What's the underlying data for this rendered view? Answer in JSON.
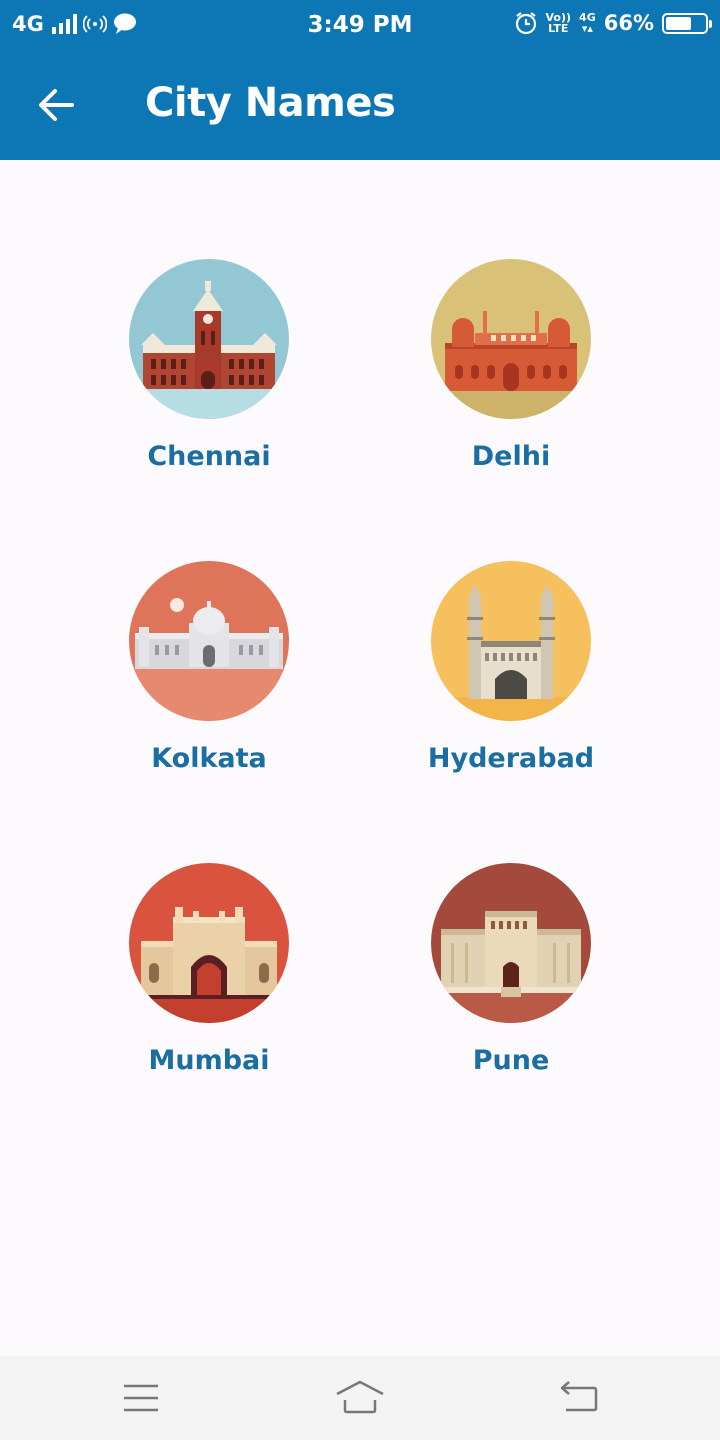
{
  "status_bar": {
    "network": "4G",
    "time": "3:49 PM",
    "volte_top": "Vo))",
    "volte_bottom": "LTE",
    "net_type": "4G",
    "battery_percent": "66%",
    "battery_level": 0.66
  },
  "header": {
    "title": "City Names",
    "background_color": "#0d77b5"
  },
  "cities": [
    {
      "name": "Chennai",
      "icon": "chennai-central-icon",
      "bg_color": "#93c7d3"
    },
    {
      "name": "Delhi",
      "icon": "red-fort-icon",
      "bg_color": "#d9c178"
    },
    {
      "name": "Kolkata",
      "icon": "victoria-memorial-icon",
      "bg_color": "#de745a"
    },
    {
      "name": "Hyderabad",
      "icon": "charminar-icon",
      "bg_color": "#f7c05e"
    },
    {
      "name": "Mumbai",
      "icon": "gateway-of-india-icon",
      "bg_color": "#d9533f"
    },
    {
      "name": "Pune",
      "icon": "shaniwar-wada-icon",
      "bg_color": "#a34a3c"
    }
  ],
  "nav_bar": {
    "buttons": [
      "menu-icon",
      "home-icon",
      "back-icon"
    ]
  },
  "label_color": "#1a6ea3"
}
